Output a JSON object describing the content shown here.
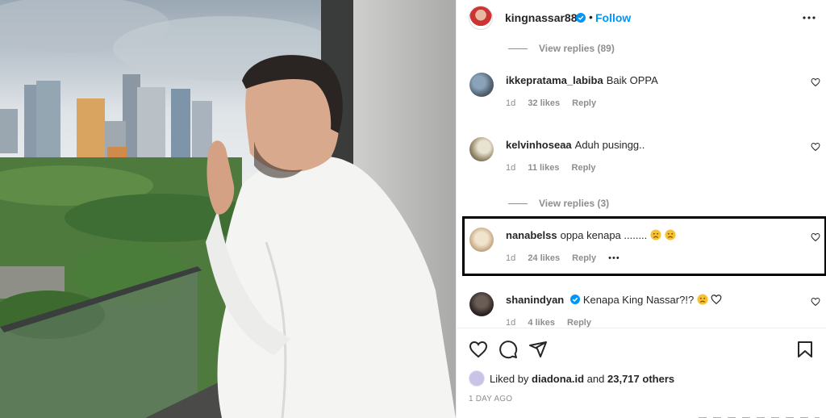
{
  "post": {
    "username": "kingnassar88",
    "follow_label": "Follow",
    "separator": "•",
    "more_icon": "more-options-icon"
  },
  "comments": {
    "view_replies_top": "View replies (89)",
    "items": [
      {
        "username": "ikkepratama_labiba",
        "text": "Baik OPPA",
        "time": "1d",
        "likes": "32 likes",
        "reply": "Reply"
      },
      {
        "username": "kelvinhoseaa",
        "text": "Aduh pusingg..",
        "time": "1d",
        "likes": "11 likes",
        "reply": "Reply"
      },
      {
        "username": "nanabelss",
        "text": "oppa kenapa ........",
        "time": "1d",
        "likes": "24 likes",
        "reply": "Reply",
        "more": "•••"
      },
      {
        "username": "shanindyan",
        "text": "Kenapa King Nassar?!?",
        "time": "1d",
        "likes": "4 likes",
        "reply": "Reply"
      }
    ],
    "view_replies_mid": "View replies (3)"
  },
  "footer": {
    "liked_prefix": "Liked by",
    "liked_user": "diadona.id",
    "liked_and": "and",
    "liked_count": "23,717 others",
    "ago": "1 DAY AGO"
  },
  "colors": {
    "accent": "#0095f6",
    "verified": "#0095f6",
    "muted": "#8e8e8e",
    "highlight_border": "#000000"
  }
}
